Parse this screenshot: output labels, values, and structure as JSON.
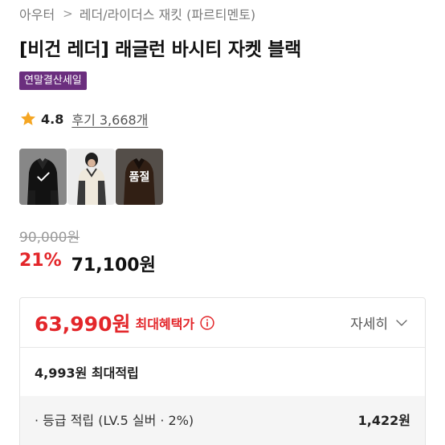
{
  "breadcrumb": {
    "level1": "아우터",
    "separator": ">",
    "level2": "레더/라이더스 재킷 (파르티멘토)"
  },
  "product": {
    "title": "[비건 레더] 래글런 바시티 자켓 블랙",
    "badge": "연말결산세일",
    "badge_color": "#6b2e7e"
  },
  "rating": {
    "star_icon": "star-icon",
    "star_color": "#f5a623",
    "score": "4.8",
    "reviews": "후기 3,668개"
  },
  "thumbnails": [
    {
      "name": "black-jacket",
      "selected": true,
      "soldout": false,
      "overlay_text": ""
    },
    {
      "name": "cream-jacket-model",
      "selected": false,
      "soldout": false,
      "overlay_text": ""
    },
    {
      "name": "brown-jacket",
      "selected": false,
      "soldout": true,
      "overlay_text": "품절"
    }
  ],
  "price": {
    "original": "90,000원",
    "discount": "21%",
    "sale": "71,100원"
  },
  "benefit": {
    "best_price": "63,990원",
    "best_label": "최대혜택가",
    "detail_label": "자세히",
    "points_summary": "4,993원 최대적립",
    "lines": [
      {
        "label": "· 등급 적립 (LV.5 실버 · 2%)",
        "amount": "1,422원"
      }
    ],
    "accent_color": "#e3262a"
  }
}
